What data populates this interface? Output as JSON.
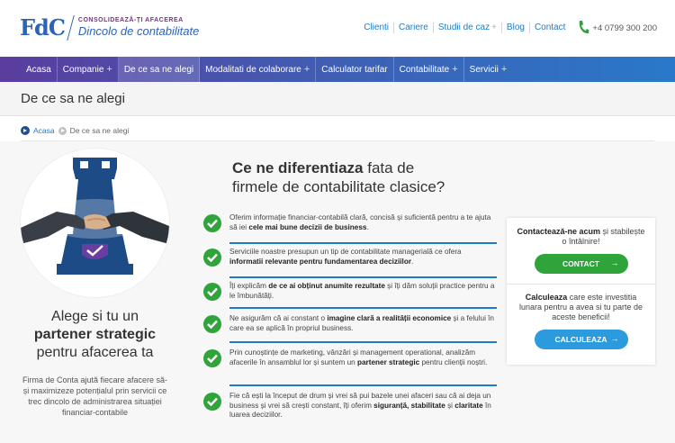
{
  "header": {
    "logo_mark": "FdC",
    "logo_tag": "CONSOLIDEAZĂ-ȚI AFACEREA",
    "logo_name": "Dincolo de contabilitate",
    "topnav": [
      "Clienti",
      "Cariere",
      "Studii de caz",
      "Blog",
      "Contact"
    ],
    "phone": "+4 0799 300 200"
  },
  "mainnav": {
    "items": [
      {
        "label": "Acasa",
        "plus": false
      },
      {
        "label": "Companie",
        "plus": true
      },
      {
        "label": "De ce sa ne alegi",
        "plus": false
      },
      {
        "label": "Modalitati de colaborare",
        "plus": true
      },
      {
        "label": "Calculator tarifar",
        "plus": false
      },
      {
        "label": "Contabilitate",
        "plus": true
      },
      {
        "label": "Servicii",
        "plus": true
      }
    ],
    "gradient": [
      "#5a3d9e",
      "#2a78c9"
    ]
  },
  "page_title": "De ce sa ne alegi",
  "breadcrumb": {
    "home": "Acasa",
    "current": "De ce sa ne alegi"
  },
  "left": {
    "alege_1": "Alege si tu un",
    "alege_2": "partener strategic",
    "alege_3": "pentru afacerea ta",
    "firma": "Firma de Conta ajută fiecare afacere să-și maximizeze potențialul prin servicii ce trec dincolo de administrarea situației financiar-contabile"
  },
  "middle": {
    "heading_bold": "Ce ne diferentiaza",
    "heading_rest_1": " fata de",
    "heading_rest_2": "firmele de contabilitate clasice?"
  },
  "list_items": [
    {
      "pre": "Oferim informație financiar-contabilă clară, concisă și suficientă pentru a te ajuta să iei ",
      "bold": "cele mai bune decizii de business",
      "post": "."
    },
    {
      "pre": "Serviciile noastre presupun un tip de contabilitate managerială ce ofera ",
      "bold": "informatii relevante pentru fundamentarea deciziilor",
      "post": "."
    },
    {
      "pre": "Îți explicăm ",
      "bold": "de ce ai obținut anumite rezultate",
      "post": " și îți dăm soluții practice pentru a le îmbunătăți."
    },
    {
      "pre": "Ne asigurăm că ai constant o ",
      "bold": "imagine clară a realității economice",
      "post": " și a felului în care ea se aplică în propriul business."
    },
    {
      "pre": "Prin cunoștințe de marketing, vânzări și management operational, analizăm afacerile în ansamblul lor și suntem un ",
      "bold": "partener strategic",
      "post": " pentru clienții noștri."
    },
    {
      "pre": "Fie că ești la început de drum și vrei să pui bazele unei afaceri sau că ai deja un business și vrei să crești constant, îți oferim ",
      "bold": "siguranță, stabilitate",
      "post": " și ",
      "bold2": "claritate",
      "post2": " în luarea deciziilor."
    }
  ],
  "card": {
    "contact_bold": "Contactează-ne acum",
    "contact_rest": " și stabilește o întâlnire!",
    "contact_btn": "CONTACT",
    "calc_bold": "Calculeaza",
    "calc_rest": " care este investitia lunara pentru a avea si tu parte de aceste beneficii!",
    "calc_btn": "CALCULEAZA",
    "arrow": "→"
  },
  "colors": {
    "green": "#2ea43a",
    "blue": "#2b9bde",
    "link": "#1f7cc4",
    "brand": "#2c63b8"
  }
}
